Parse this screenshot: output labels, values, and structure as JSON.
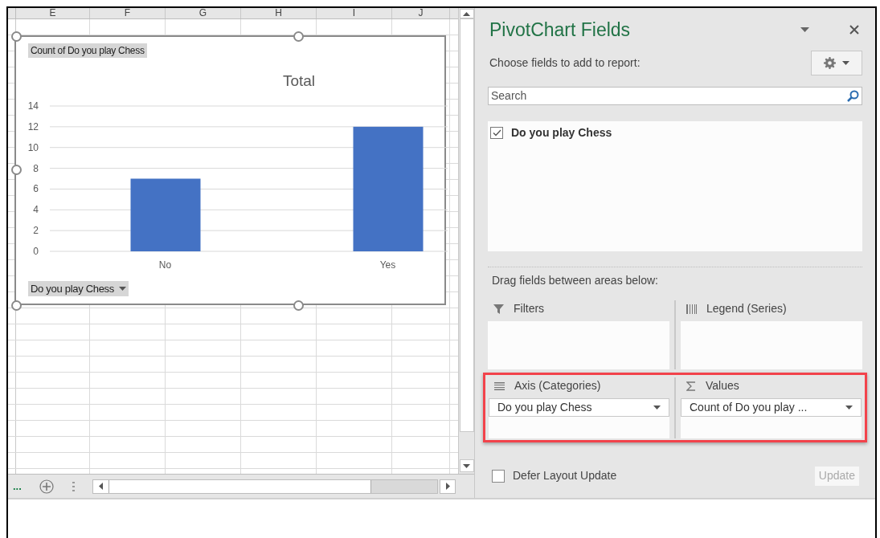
{
  "sheet": {
    "columns": [
      "E",
      "F",
      "G",
      "H",
      "I",
      "J"
    ],
    "tabs_overflow": "..."
  },
  "chart": {
    "value_field_button": "Count of Do you play Chess",
    "axis_field_button": "Do you play Chess",
    "chart_data": {
      "type": "bar",
      "grid": true,
      "categories": [
        "No",
        "Yes"
      ],
      "series": [
        {
          "name": "Total",
          "color": "#4472c4",
          "values": [
            7,
            12
          ]
        }
      ],
      "ylim": [
        0,
        14
      ],
      "yticks": [
        0,
        2,
        4,
        6,
        8,
        10,
        12,
        14
      ]
    }
  },
  "pane": {
    "title": "PivotChart Fields",
    "subtitle": "Choose fields to add to report:",
    "search": {
      "placeholder": "Search"
    },
    "fields": [
      {
        "label": "Do you play Chess",
        "checked": true
      }
    ],
    "areas_label": "Drag fields between areas below:",
    "area_rows": [
      {
        "highlighted": false,
        "areas": [
          {
            "kind": "filters",
            "title": "Filters"
          },
          {
            "kind": "legend",
            "title": "Legend (Series)"
          }
        ]
      },
      {
        "highlighted": true,
        "areas": [
          {
            "kind": "axis",
            "title": "Axis (Categories)",
            "items": [
              "Do you play Chess"
            ]
          },
          {
            "kind": "values",
            "title": "Values",
            "items": [
              "Count of Do you play ..."
            ]
          }
        ]
      }
    ],
    "defer": {
      "label": "Defer Layout Update",
      "checked": false
    },
    "update_button": {
      "label": "Update",
      "disabled": true
    }
  }
}
